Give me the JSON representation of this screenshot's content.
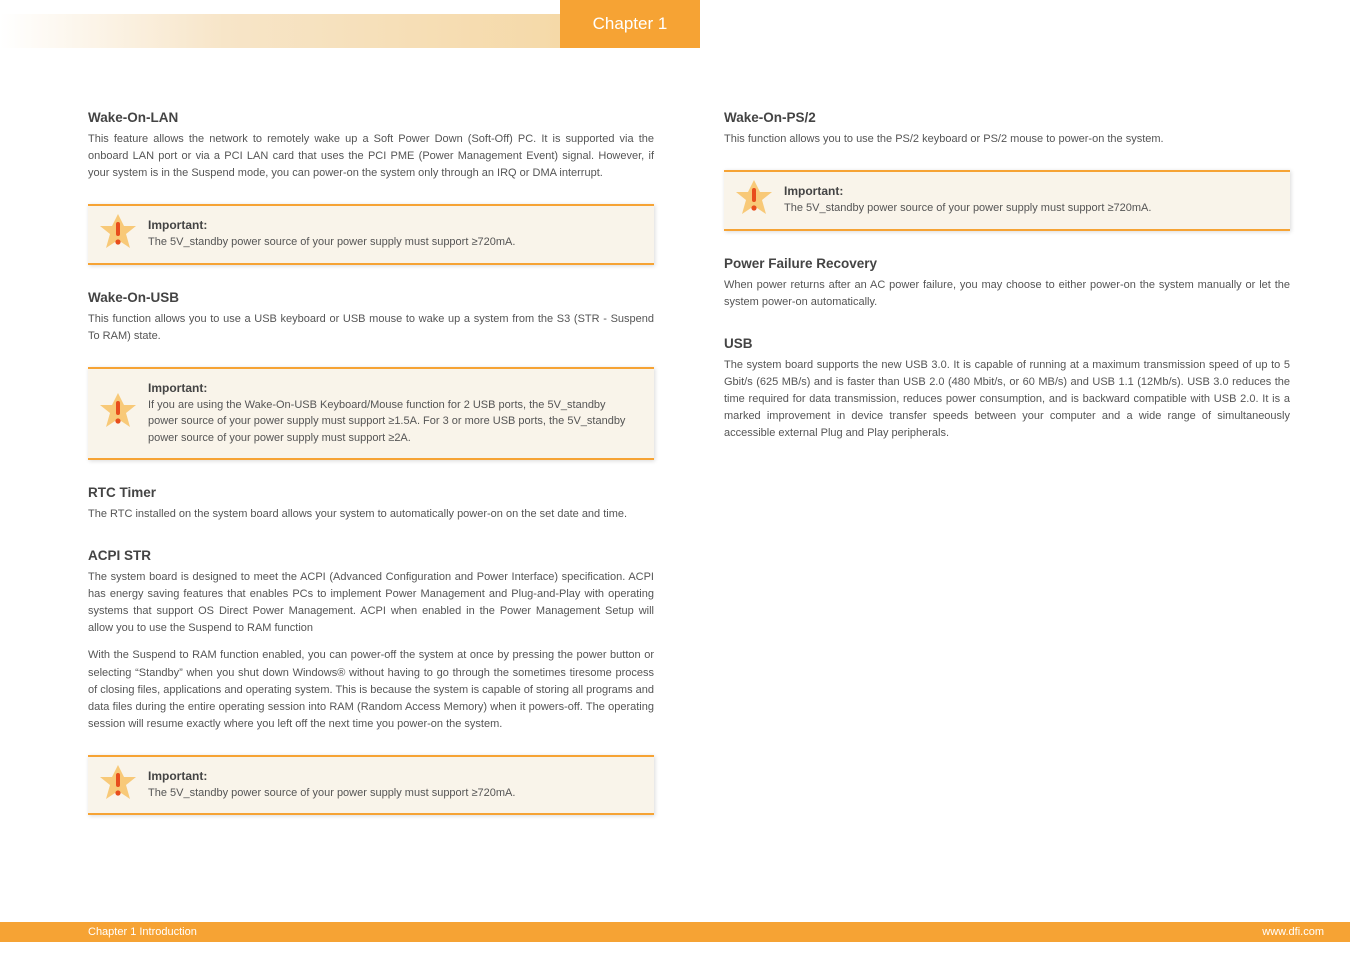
{
  "header": {
    "chapter_tab": "Chapter 1"
  },
  "left": {
    "sec1": {
      "title": "Wake-On-LAN",
      "body": "This feature allows the network to remotely wake up a Soft Power Down (Soft-Off) PC. It is supported via the onboard LAN port or via a PCI LAN card that uses the PCI PME (Power Management Event) signal. However, if your system is in the Suspend mode, you can power-on the system only through an IRQ or DMA interrupt."
    },
    "note1": {
      "label": "Important:",
      "text": "The 5V_standby power source of your power supply must support ≥720mA."
    },
    "sec2": {
      "title": "Wake-On-USB",
      "body": "This function allows you to use a USB keyboard or USB mouse to wake up a system from the S3 (STR - Suspend To RAM) state."
    },
    "note2": {
      "label": "Important:",
      "text": "If you are using the Wake-On-USB Keyboard/Mouse function for 2 USB ports, the 5V_standby power source of your power supply must support ≥1.5A. For 3 or more USB ports, the 5V_standby power source of your power supply must support ≥2A."
    },
    "sec3": {
      "title": "RTC Timer",
      "body": "The RTC installed on the system board allows your system to automatically power-on on the set date and time."
    },
    "sec4": {
      "title": "ACPI STR",
      "body1": "The system board is designed to meet the ACPI (Advanced Configuration and Power Interface) specification. ACPI has energy saving features that enables PCs to implement Power Management and Plug-and-Play with operating systems that support OS Direct Power Management. ACPI when enabled in the Power Management Setup will allow you to use the Suspend to RAM function",
      "body2": "With the Suspend to RAM function enabled, you can power-off the system at once by pressing the power button or selecting “Standby” when you shut down Windows® without having to go through the sometimes tiresome process of closing files, applications and operating system. This is because the system is capable of storing all programs and data files during the entire operating session into RAM (Random Access Memory) when it powers-off. The operating session will resume exactly where you left off the next time you power-on the system."
    },
    "note3": {
      "label": "Important:",
      "text": "The 5V_standby power source of your power supply must support ≥720mA."
    }
  },
  "right": {
    "sec1": {
      "title": "Wake-On-PS/2",
      "body": "This function allows you to use the PS/2 keyboard or PS/2 mouse to power-on the system."
    },
    "note1": {
      "label": "Important:",
      "text": "The 5V_standby power source of your power supply must support ≥720mA."
    },
    "sec2": {
      "title": "Power Failure Recovery",
      "body": "When power returns after an AC power failure, you may choose to either power-on the system manually or let the system power-on automatically."
    },
    "sec3": {
      "title": "USB",
      "body": "The system board supports the new USB 3.0. It is capable of running at a maximum transmission speed of up to 5 Gbit/s (625 MB/s) and is faster than USB 2.0 (480 Mbit/s, or 60 MB/s) and USB 1.1 (12Mb/s). USB 3.0 reduces the time required for data transmission, reduces power consumption, and is backward compatible with USB 2.0. It is  a marked  improvement  in  device  transfer  speeds  between  your  computer  and  a wide range of simultaneously accessible external Plug and Play peripherals."
    }
  },
  "footer": {
    "left": "Chapter 1 Introduction",
    "right": "www.dfi.com"
  }
}
